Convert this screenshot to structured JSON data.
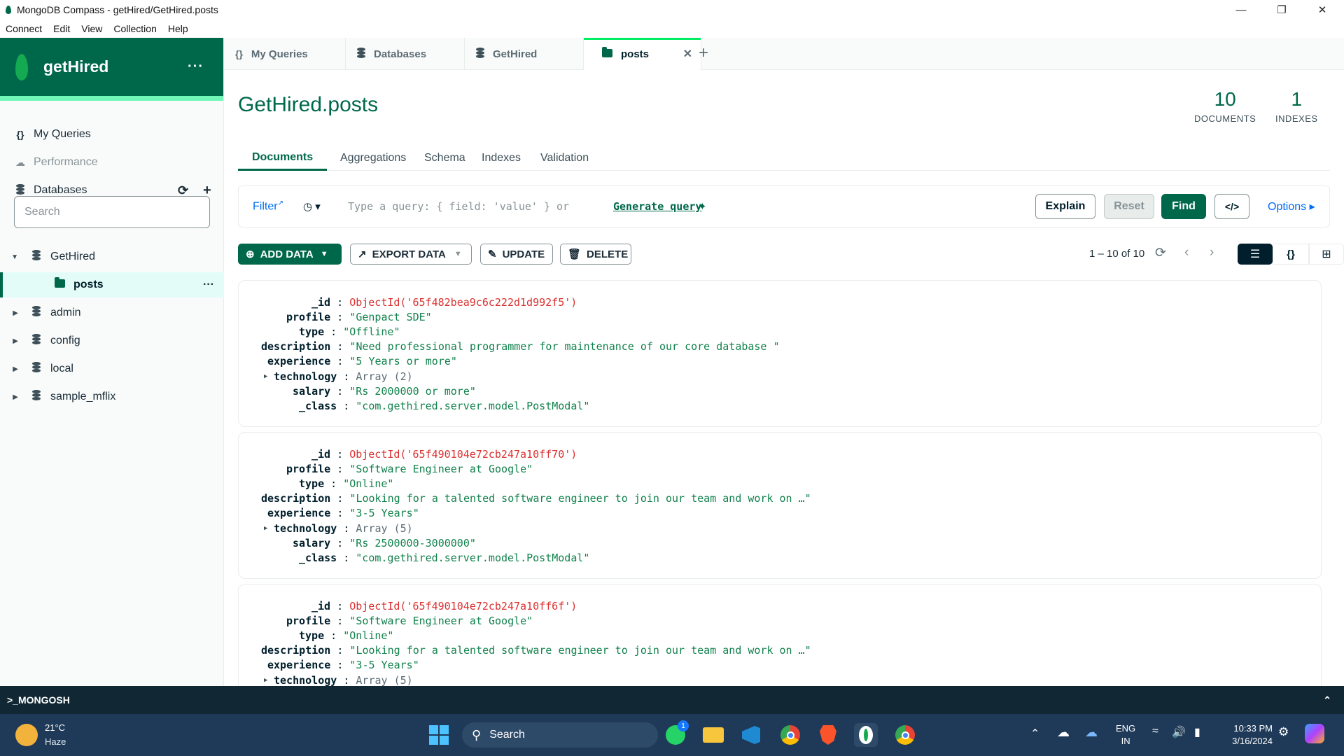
{
  "window": {
    "title": "MongoDB Compass - getHired/GetHired.posts"
  },
  "menu": [
    "Connect",
    "Edit",
    "View",
    "Collection",
    "Help"
  ],
  "sidebar": {
    "connection_name": "getHired",
    "nav": {
      "my_queries": "My Queries",
      "performance": "Performance",
      "databases": "Databases"
    },
    "search_placeholder": "Search",
    "tree": [
      {
        "label": "GetHired",
        "expanded": true
      },
      {
        "label": "posts",
        "selected": true
      },
      {
        "label": "admin"
      },
      {
        "label": "config"
      },
      {
        "label": "local"
      },
      {
        "label": "sample_mflix"
      }
    ]
  },
  "tabs": [
    {
      "label": "My Queries",
      "icon": "braces-icon"
    },
    {
      "label": "Databases",
      "icon": "database-icon"
    },
    {
      "label": "GetHired",
      "icon": "database-icon"
    },
    {
      "label": "posts",
      "icon": "folder-icon",
      "active": true
    }
  ],
  "collection": {
    "title": "GetHired.posts",
    "documents_count": "10",
    "documents_label": "DOCUMENTS",
    "indexes_count": "1",
    "indexes_label": "INDEXES"
  },
  "subtabs": [
    {
      "label": "Documents",
      "active": true
    },
    {
      "label": "Aggregations"
    },
    {
      "label": "Schema"
    },
    {
      "label": "Indexes"
    },
    {
      "label": "Validation"
    }
  ],
  "query": {
    "filter_label": "Filter",
    "placeholder": "Type a query: { field: 'value' } or",
    "generate_link": "Generate query",
    "explain": "Explain",
    "reset": "Reset",
    "find": "Find",
    "code_label": "</>",
    "options": "Options"
  },
  "actions": {
    "add_data": "ADD DATA",
    "export_data": "EXPORT DATA",
    "update": "UPDATE",
    "delete": "DELETE",
    "pagination": "1 – 10 of 10"
  },
  "documents": [
    {
      "fields": [
        {
          "key": "_id",
          "value": "ObjectId('65f482bea9c6c222d1d992f5')",
          "kind": "oid"
        },
        {
          "key": "profile",
          "value": "\"Genpact SDE\"",
          "kind": "str"
        },
        {
          "key": "type",
          "value": "\"Offline\"",
          "kind": "str"
        },
        {
          "key": "description",
          "value": "\"Need professional programmer for maintenance of our core database \"",
          "kind": "str"
        },
        {
          "key": "experience",
          "value": "\"5 Years or more\"",
          "kind": "str"
        },
        {
          "key": "technology",
          "value": "Array (2)",
          "kind": "arr"
        },
        {
          "key": "salary",
          "value": "\"Rs 2000000 or more\"",
          "kind": "str"
        },
        {
          "key": "_class",
          "value": "\"com.gethired.server.model.PostModal\"",
          "kind": "str"
        }
      ]
    },
    {
      "fields": [
        {
          "key": "_id",
          "value": "ObjectId('65f490104e72cb247a10ff70')",
          "kind": "oid"
        },
        {
          "key": "profile",
          "value": "\"Software Engineer at Google\"",
          "kind": "str"
        },
        {
          "key": "type",
          "value": "\"Online\"",
          "kind": "str"
        },
        {
          "key": "description",
          "value": "\"Looking for a talented software engineer to join our team and work on …\"",
          "kind": "str"
        },
        {
          "key": "experience",
          "value": "\"3-5 Years\"",
          "kind": "str"
        },
        {
          "key": "technology",
          "value": "Array (5)",
          "kind": "arr"
        },
        {
          "key": "salary",
          "value": "\"Rs 2500000-3000000\"",
          "kind": "str"
        },
        {
          "key": "_class",
          "value": "\"com.gethired.server.model.PostModal\"",
          "kind": "str"
        }
      ]
    },
    {
      "fields": [
        {
          "key": "_id",
          "value": "ObjectId('65f490104e72cb247a10ff6f')",
          "kind": "oid"
        },
        {
          "key": "profile",
          "value": "\"Software Engineer at Google\"",
          "kind": "str"
        },
        {
          "key": "type",
          "value": "\"Online\"",
          "kind": "str"
        },
        {
          "key": "description",
          "value": "\"Looking for a talented software engineer to join our team and work on …\"",
          "kind": "str"
        },
        {
          "key": "experience",
          "value": "\"3-5 Years\"",
          "kind": "str"
        },
        {
          "key": "technology",
          "value": "Array (5)",
          "kind": "arr"
        }
      ]
    }
  ],
  "mongosh": {
    "label": ">_MONGOSH"
  },
  "taskbar": {
    "weather_temp": "21°C",
    "weather_desc": "Haze",
    "search": "Search",
    "lang": "ENG",
    "region": "IN",
    "time": "10:33 PM",
    "date": "3/16/2024",
    "whatsapp_badge": "1"
  },
  "colors": {
    "brand": "#00684a",
    "accent": "#00ed64",
    "taskbar": "#1f3a58",
    "oid": "#db3030",
    "string": "#12824d"
  }
}
